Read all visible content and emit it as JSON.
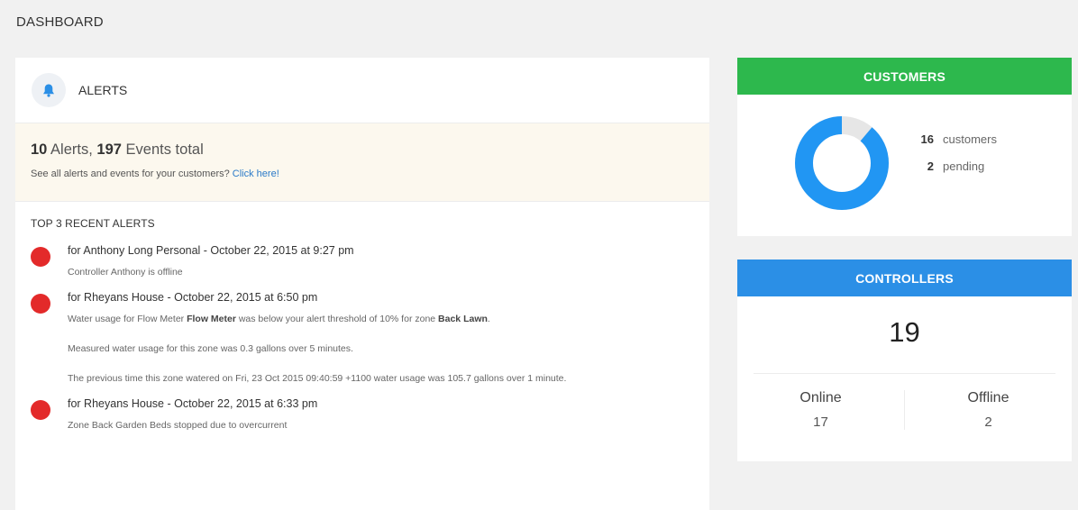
{
  "page": {
    "title": "DASHBOARD"
  },
  "alerts": {
    "title": "ALERTS",
    "icon": "bell-icon",
    "summary": {
      "alerts_count": "10",
      "alerts_word": "Alerts,",
      "events_count": "197",
      "events_word": "Events total",
      "prompt": "See all alerts and events for your customers?",
      "link": "Click here!"
    },
    "recent_title": "TOP 3 RECENT ALERTS",
    "items": [
      {
        "heading": "for Anthony Long Personal - October 22, 2015 at 9:27 pm",
        "detail": "Controller Anthony is offline"
      },
      {
        "heading": "for Rheyans House - October 22, 2015 at 6:50 pm",
        "detail_a": "Water usage for Flow Meter ",
        "detail_b": "Flow Meter",
        "detail_c": " was below your alert threshold of 10% for zone ",
        "detail_d": "Back Lawn",
        "detail_e": ".",
        "detail_2": "Measured water usage for this zone was 0.3 gallons over 5 minutes.",
        "detail_3": "The previous time this zone watered on Fri, 23 Oct 2015 09:40:59 +1100 water usage was 105.7 gallons over 1 minute."
      },
      {
        "heading": "for Rheyans House - October 22, 2015 at 6:33 pm",
        "detail": "Zone Back Garden Beds stopped due to overcurrent"
      }
    ]
  },
  "customers": {
    "title": "CUSTOMERS",
    "count": "16",
    "count_label": "customers",
    "pending": "2",
    "pending_label": "pending",
    "donut": {
      "active": 16,
      "pending": 2,
      "active_color": "#2196f3",
      "pending_color": "#e6e6e6"
    }
  },
  "controllers": {
    "title": "CONTROLLERS",
    "total": "19",
    "online_label": "Online",
    "online": "17",
    "offline_label": "Offline",
    "offline": "2"
  },
  "colors": {
    "customers_header": "#2db84d",
    "controllers_header": "#2b8fe6",
    "alert_dot": "#e32a2a",
    "link": "#2a7ac8"
  }
}
